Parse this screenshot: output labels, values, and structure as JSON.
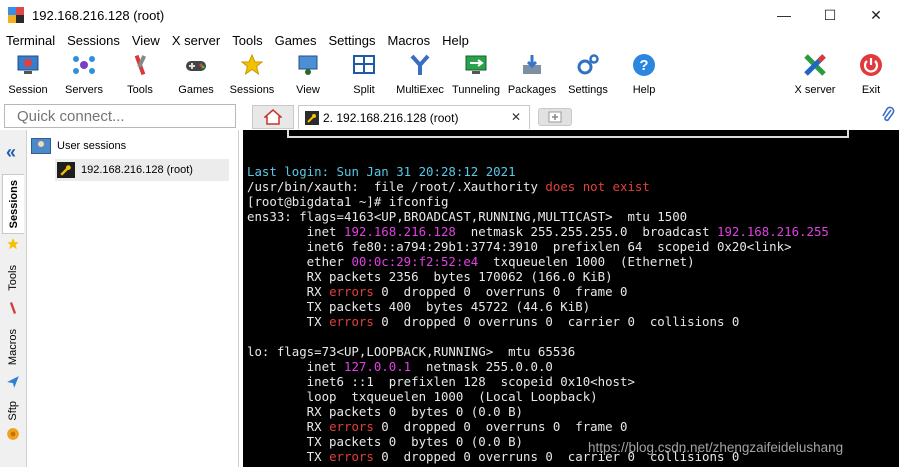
{
  "window": {
    "title": "192.168.216.128 (root)",
    "minimize": "—",
    "maximize": "☐",
    "close": "✕"
  },
  "menu": [
    "Terminal",
    "Sessions",
    "View",
    "X server",
    "Tools",
    "Games",
    "Settings",
    "Macros",
    "Help"
  ],
  "toolbar": {
    "left": [
      {
        "label": "Session",
        "icon": "session-icon"
      },
      {
        "label": "Servers",
        "icon": "servers-icon"
      },
      {
        "label": "Tools",
        "icon": "tools-icon"
      },
      {
        "label": "Games",
        "icon": "games-icon"
      },
      {
        "label": "Sessions",
        "icon": "sessions-star-icon"
      },
      {
        "label": "View",
        "icon": "view-icon"
      },
      {
        "label": "Split",
        "icon": "split-icon"
      },
      {
        "label": "MultiExec",
        "icon": "multiexec-icon"
      },
      {
        "label": "Tunneling",
        "icon": "tunneling-icon"
      },
      {
        "label": "Packages",
        "icon": "packages-icon"
      },
      {
        "label": "Settings",
        "icon": "settings-icon"
      },
      {
        "label": "Help",
        "icon": "help-icon"
      }
    ],
    "right": [
      {
        "label": "X server",
        "icon": "xserver-icon"
      },
      {
        "label": "Exit",
        "icon": "exit-icon"
      }
    ]
  },
  "quick_connect": {
    "placeholder": "Quick connect..."
  },
  "tabs": {
    "session_tab": "2. 192.168.216.128 (root)",
    "close": "✕"
  },
  "side_tabs": [
    "Sessions",
    "Tools",
    "Macros",
    "Sftp"
  ],
  "sessions_tree": {
    "root": "User sessions",
    "child": "192.168.216.128 (root)"
  },
  "terminal_lines": [
    [
      {
        "t": "Last login: ",
        "c": "cyan"
      },
      {
        "t": "Sun Jan 31 20:28:12 2021",
        "c": "cyan"
      }
    ],
    [
      {
        "t": "/usr/bin/xauth:  file /root/.Xauthority ",
        "c": "gray"
      },
      {
        "t": "does not exist",
        "c": "red"
      }
    ],
    [
      {
        "t": "[root@bigdata1 ~]# ifconfig",
        "c": "gray"
      }
    ],
    [
      {
        "t": "ens33: flags=4163<UP,BROADCAST,RUNNING,MULTICAST>  mtu 1500",
        "c": "gray"
      }
    ],
    [
      {
        "t": "        inet ",
        "c": "gray"
      },
      {
        "t": "192.168.216.128",
        "c": "mag"
      },
      {
        "t": "  netmask 255.255.255.0  broadcast ",
        "c": "gray"
      },
      {
        "t": "192.168.216.255",
        "c": "mag"
      }
    ],
    [
      {
        "t": "        inet6 fe80::a794:29b1:3774:3910  prefixlen 64  scopeid 0x20<link>",
        "c": "gray"
      }
    ],
    [
      {
        "t": "        ether ",
        "c": "gray"
      },
      {
        "t": "00:0c:29:f2:52:e4",
        "c": "mag"
      },
      {
        "t": "  txqueuelen 1000  (Ethernet)",
        "c": "gray"
      }
    ],
    [
      {
        "t": "        RX packets 2356  bytes 170062 (166.0 KiB)",
        "c": "gray"
      }
    ],
    [
      {
        "t": "        RX ",
        "c": "gray"
      },
      {
        "t": "errors",
        "c": "red"
      },
      {
        "t": " 0  dropped 0  overruns 0  frame 0",
        "c": "gray"
      }
    ],
    [
      {
        "t": "        TX packets 400  bytes 45722 (44.6 KiB)",
        "c": "gray"
      }
    ],
    [
      {
        "t": "        TX ",
        "c": "gray"
      },
      {
        "t": "errors",
        "c": "red"
      },
      {
        "t": " 0  dropped 0 overruns 0  carrier 0  collisions 0",
        "c": "gray"
      }
    ],
    [
      {
        "t": "",
        "c": "gray"
      }
    ],
    [
      {
        "t": "lo: flags=73<UP,LOOPBACK,RUNNING>  mtu 65536",
        "c": "gray"
      }
    ],
    [
      {
        "t": "        inet ",
        "c": "gray"
      },
      {
        "t": "127.0.0.1",
        "c": "mag"
      },
      {
        "t": "  netmask 255.0.0.0",
        "c": "gray"
      }
    ],
    [
      {
        "t": "        inet6 ::1  prefixlen 128  scopeid 0x10<host>",
        "c": "gray"
      }
    ],
    [
      {
        "t": "        loop  txqueuelen 1000  (Local Loopback)",
        "c": "gray"
      }
    ],
    [
      {
        "t": "        RX packets 0  bytes 0 (0.0 B)",
        "c": "gray"
      }
    ],
    [
      {
        "t": "        RX ",
        "c": "gray"
      },
      {
        "t": "errors",
        "c": "red"
      },
      {
        "t": " 0  dropped 0  overruns 0  frame 0",
        "c": "gray"
      }
    ],
    [
      {
        "t": "        TX packets 0  bytes 0 (0.0 B)",
        "c": "gray"
      }
    ],
    [
      {
        "t": "        TX ",
        "c": "gray"
      },
      {
        "t": "errors",
        "c": "red"
      },
      {
        "t": " 0  dropped 0 overruns 0  carrier 0  collisions 0",
        "c": "gray"
      }
    ]
  ],
  "watermark": "https://blog.csdn.net/zhengzaifeidelushang",
  "colors": {
    "terminal_bg": "#000000",
    "prompt_cyan": "#5ac8e8",
    "error_red": "#e0403a",
    "ip_magenta": "#e040e0",
    "accent_blue": "#1e5fb3"
  }
}
